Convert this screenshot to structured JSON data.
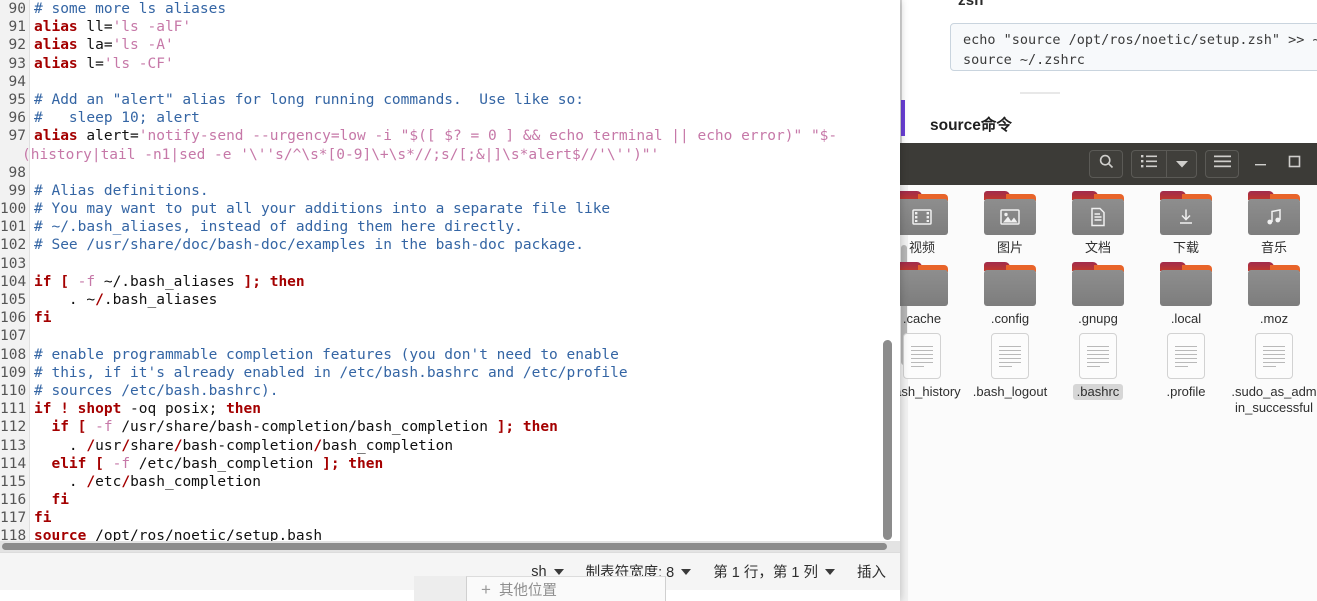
{
  "editor": {
    "app": "gedit",
    "filename": ".bashrc",
    "lines": [
      {
        "num": "90",
        "segments": [
          {
            "cls": "t-cmt",
            "text": "# some more ls aliases"
          }
        ]
      },
      {
        "num": "91",
        "segments": [
          {
            "cls": "t-kw",
            "text": "alias"
          },
          {
            "cls": "t-plain",
            "text": " ll="
          },
          {
            "cls": "t-str",
            "text": "'ls -alF'"
          }
        ]
      },
      {
        "num": "92",
        "segments": [
          {
            "cls": "t-kw",
            "text": "alias"
          },
          {
            "cls": "t-plain",
            "text": " la="
          },
          {
            "cls": "t-str",
            "text": "'ls -A'"
          }
        ]
      },
      {
        "num": "93",
        "segments": [
          {
            "cls": "t-kw",
            "text": "alias"
          },
          {
            "cls": "t-plain",
            "text": " l="
          },
          {
            "cls": "t-str",
            "text": "'ls -CF'"
          }
        ]
      },
      {
        "num": "94",
        "segments": []
      },
      {
        "num": "95",
        "segments": [
          {
            "cls": "t-cmt",
            "text": "# Add an \"alert\" alias for long running commands.  Use like so:"
          }
        ]
      },
      {
        "num": "96",
        "segments": [
          {
            "cls": "t-cmt",
            "text": "#   sleep 10; alert"
          }
        ]
      },
      {
        "num": "97",
        "segments": [
          {
            "cls": "t-kw",
            "text": "alias"
          },
          {
            "cls": "t-plain",
            "text": " alert="
          },
          {
            "cls": "t-str",
            "text": "'notify-send --urgency=low -i \"$([ $? = 0 ] && echo terminal || echo error)\" \"$-"
          }
        ]
      },
      {
        "num": "",
        "cont": true,
        "segments": [
          {
            "cls": "t-str",
            "text": "(history|tail -n1|sed -e '\\''s/^\\s*[0-9]\\+\\s*//;s/[;&|]\\s*alert$//'\\'')\"'"
          }
        ]
      },
      {
        "num": "98",
        "segments": []
      },
      {
        "num": "99",
        "segments": [
          {
            "cls": "t-cmt",
            "text": "# Alias definitions."
          }
        ]
      },
      {
        "num": "100",
        "segments": [
          {
            "cls": "t-cmt",
            "text": "# You may want to put all your additions into a separate file like"
          }
        ]
      },
      {
        "num": "101",
        "segments": [
          {
            "cls": "t-cmt",
            "text": "# ~/.bash_aliases, instead of adding them here directly."
          }
        ]
      },
      {
        "num": "102",
        "segments": [
          {
            "cls": "t-cmt",
            "text": "# See /usr/share/doc/bash-doc/examples in the bash-doc package."
          }
        ]
      },
      {
        "num": "103",
        "segments": []
      },
      {
        "num": "104",
        "segments": [
          {
            "cls": "t-kw",
            "text": "if ["
          },
          {
            "cls": "t-opt",
            "text": " -f "
          },
          {
            "cls": "t-plain",
            "text": "~/.bash_aliases "
          },
          {
            "cls": "t-kw",
            "text": "]; then"
          }
        ]
      },
      {
        "num": "105",
        "segments": [
          {
            "cls": "t-plain",
            "text": "    . ~"
          },
          {
            "cls": "t-path-b",
            "text": "/"
          },
          {
            "cls": "t-plain",
            "text": ".bash_aliases"
          }
        ]
      },
      {
        "num": "106",
        "segments": [
          {
            "cls": "t-kw",
            "text": "fi"
          }
        ]
      },
      {
        "num": "107",
        "segments": []
      },
      {
        "num": "108",
        "segments": [
          {
            "cls": "t-cmt",
            "text": "# enable programmable completion features (you don't need to enable"
          }
        ]
      },
      {
        "num": "109",
        "segments": [
          {
            "cls": "t-cmt",
            "text": "# this, if it's already enabled in /etc/bash.bashrc and /etc/profile"
          }
        ]
      },
      {
        "num": "110",
        "segments": [
          {
            "cls": "t-cmt",
            "text": "# sources /etc/bash.bashrc)."
          }
        ]
      },
      {
        "num": "111",
        "segments": [
          {
            "cls": "t-kw",
            "text": "if ! shopt"
          },
          {
            "cls": "t-plain",
            "text": " -oq posix; "
          },
          {
            "cls": "t-kw",
            "text": "then"
          }
        ]
      },
      {
        "num": "112",
        "segments": [
          {
            "cls": "t-plain",
            "text": "  "
          },
          {
            "cls": "t-kw",
            "text": "if ["
          },
          {
            "cls": "t-opt",
            "text": " -f "
          },
          {
            "cls": "t-plain",
            "text": "/usr/share/bash-completion/bash_completion "
          },
          {
            "cls": "t-kw",
            "text": "]; then"
          }
        ]
      },
      {
        "num": "113",
        "segments": [
          {
            "cls": "t-plain",
            "text": "    . "
          },
          {
            "cls": "t-path-b",
            "text": "/"
          },
          {
            "cls": "t-plain",
            "text": "usr"
          },
          {
            "cls": "t-path-b",
            "text": "/"
          },
          {
            "cls": "t-plain",
            "text": "share"
          },
          {
            "cls": "t-path-b",
            "text": "/"
          },
          {
            "cls": "t-plain",
            "text": "bash-completion"
          },
          {
            "cls": "t-path-b",
            "text": "/"
          },
          {
            "cls": "t-plain",
            "text": "bash_completion"
          }
        ]
      },
      {
        "num": "114",
        "segments": [
          {
            "cls": "t-plain",
            "text": "  "
          },
          {
            "cls": "t-kw",
            "text": "elif ["
          },
          {
            "cls": "t-opt",
            "text": " -f "
          },
          {
            "cls": "t-plain",
            "text": "/etc/bash_completion "
          },
          {
            "cls": "t-kw",
            "text": "]; then"
          }
        ]
      },
      {
        "num": "115",
        "segments": [
          {
            "cls": "t-plain",
            "text": "    . "
          },
          {
            "cls": "t-path-b",
            "text": "/"
          },
          {
            "cls": "t-plain",
            "text": "etc"
          },
          {
            "cls": "t-path-b",
            "text": "/"
          },
          {
            "cls": "t-plain",
            "text": "bash_completion"
          }
        ]
      },
      {
        "num": "116",
        "segments": [
          {
            "cls": "t-plain",
            "text": "  "
          },
          {
            "cls": "t-kw",
            "text": "fi"
          }
        ]
      },
      {
        "num": "117",
        "segments": [
          {
            "cls": "t-kw",
            "text": "fi"
          }
        ]
      },
      {
        "num": "118",
        "segments": [
          {
            "cls": "t-kw",
            "text": "source"
          },
          {
            "cls": "t-plain",
            "text": " /opt/ros/noetic/setup.bash"
          }
        ]
      }
    ],
    "statusbar": {
      "language": "sh",
      "tab_width": "制表符宽度: 8",
      "position": "第 1 行，第 1 列",
      "mode": "插入"
    }
  },
  "browser_doc": {
    "heading_partial": "zsh",
    "code_lines": [
      "echo \"source /opt/ros/noetic/setup.zsh\" >> ~/.z",
      "source ~/.zshrc"
    ],
    "section_heading": "source命令"
  },
  "file_manager": {
    "toolbar": {
      "search_icon": "search-icon",
      "view_icon": "list-view-icon",
      "view_dropdown_icon": "chevron-down-icon",
      "menu_icon": "hamburger-menu-icon",
      "minimize_label": "—",
      "maximize_label": "□"
    },
    "rows": [
      {
        "type": "folder",
        "items": [
          {
            "label": "视频",
            "glyph": "video-icon",
            "selected": false,
            "clipped": true
          },
          {
            "label": "图片",
            "glyph": "image-icon",
            "selected": false
          },
          {
            "label": "文档",
            "glyph": "document-icon",
            "selected": false
          },
          {
            "label": "下载",
            "glyph": "download-icon",
            "selected": false
          },
          {
            "label": "音乐",
            "glyph": "music-icon",
            "selected": false
          }
        ]
      },
      {
        "type": "folder",
        "items": [
          {
            "label": ".cache",
            "glyph": "",
            "selected": false,
            "clipped": true
          },
          {
            "label": ".config",
            "glyph": "",
            "selected": false
          },
          {
            "label": ".gnupg",
            "glyph": "",
            "selected": false
          },
          {
            "label": ".local",
            "glyph": "",
            "selected": false
          },
          {
            "label": ".moz",
            "glyph": "",
            "selected": false
          }
        ]
      },
      {
        "type": "file",
        "items": [
          {
            "label": ".bash_history",
            "selected": false,
            "clipped": true
          },
          {
            "label": ".bash_logout",
            "selected": false
          },
          {
            "label": ".bashrc",
            "selected": true
          },
          {
            "label": ".profile",
            "selected": false
          },
          {
            "label": ".sudo_as_admin_successful",
            "selected": false
          }
        ]
      }
    ]
  },
  "bottom_dialog": {
    "plus": "+",
    "label": "其他位置"
  }
}
